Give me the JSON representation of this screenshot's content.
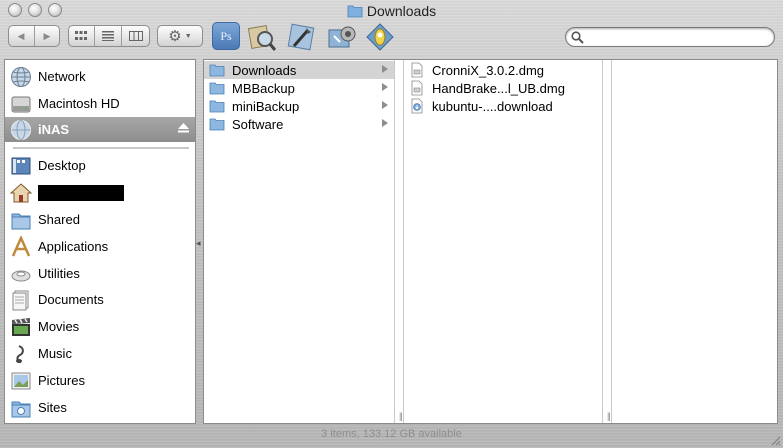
{
  "window": {
    "title": "Downloads",
    "status": "3 items, 133.12 GB available"
  },
  "toolbar": {
    "back_glyph": "◀",
    "forward_glyph": "▶",
    "action_glyph": "⚙",
    "apps": [
      {
        "icon": "photoshop-icon",
        "label": "Ps"
      },
      {
        "icon": "preview-icon"
      },
      {
        "icon": "xcode-icon"
      },
      {
        "icon": "automator-icon"
      },
      {
        "icon": "vlc-icon"
      }
    ]
  },
  "search": {
    "placeholder": "",
    "value": ""
  },
  "sidebar": {
    "devices": [
      {
        "label": "Network",
        "icon": "network-globe-icon"
      },
      {
        "label": "Macintosh HD",
        "icon": "hard-drive-icon"
      },
      {
        "label": "iNAS",
        "icon": "network-volume-icon",
        "selected": true
      }
    ],
    "places": [
      {
        "label": "Desktop",
        "icon": "desktop-icon"
      },
      {
        "label": "",
        "icon": "home-icon",
        "redacted": true
      },
      {
        "label": "Shared",
        "icon": "shared-folder-icon"
      },
      {
        "label": "Applications",
        "icon": "applications-icon"
      },
      {
        "label": "Utilities",
        "icon": "utilities-icon"
      },
      {
        "label": "Documents",
        "icon": "documents-icon"
      },
      {
        "label": "Movies",
        "icon": "movies-icon"
      },
      {
        "label": "Music",
        "icon": "music-icon"
      },
      {
        "label": "Pictures",
        "icon": "pictures-icon"
      },
      {
        "label": "Sites",
        "icon": "sites-icon"
      }
    ]
  },
  "browser": {
    "column1": [
      {
        "label": "Downloads",
        "selected": true
      },
      {
        "label": "MBBackup"
      },
      {
        "label": "miniBackup"
      },
      {
        "label": "Software"
      }
    ],
    "column2": [
      {
        "label": "CronniX_3.0.2.dmg",
        "icon": "dmg-file-icon"
      },
      {
        "label": "HandBrake...l_UB.dmg",
        "icon": "dmg-file-icon"
      },
      {
        "label": "kubuntu-....download",
        "icon": "download-file-icon"
      }
    ]
  },
  "colors": {
    "selection_sidebar": "#9a9a9a",
    "selection_column": "#d4d4d4",
    "folder_blue": "#6fa3d8"
  }
}
